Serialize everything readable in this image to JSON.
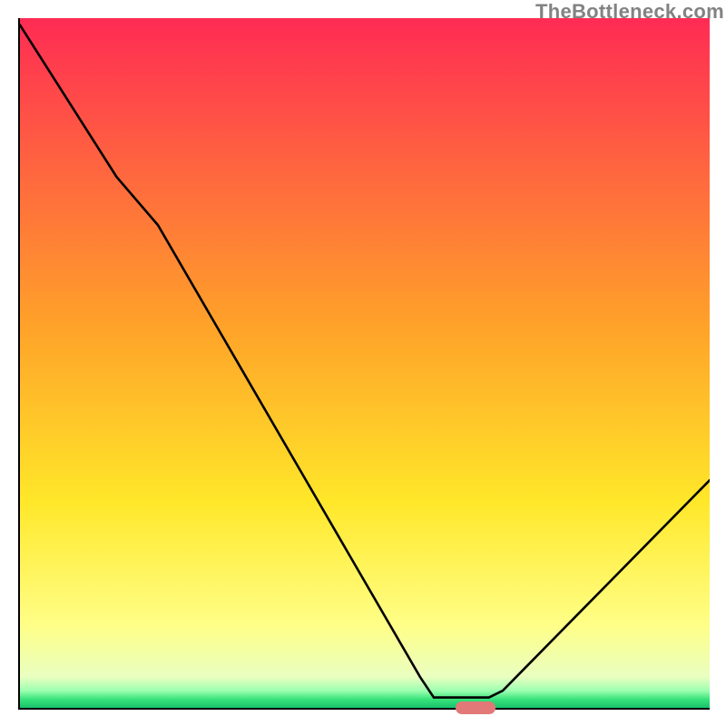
{
  "watermark": "TheBottleneck.com",
  "chart_data": {
    "type": "line",
    "xlim": [
      0,
      100
    ],
    "ylim": [
      0,
      100
    ],
    "xlabel": "",
    "ylabel": "",
    "title": "",
    "marker": {
      "x": 66,
      "y": 0,
      "color": "#e27878"
    },
    "gradient_stops": [
      {
        "offset": 0,
        "color": "#ff2b54"
      },
      {
        "offset": 0.45,
        "color": "#ffa329"
      },
      {
        "offset": 0.7,
        "color": "#ffe729"
      },
      {
        "offset": 0.88,
        "color": "#ffff87"
      },
      {
        "offset": 0.955,
        "color": "#eaffc0"
      },
      {
        "offset": 0.975,
        "color": "#9dffb1"
      },
      {
        "offset": 0.988,
        "color": "#36e27a"
      },
      {
        "offset": 1.0,
        "color": "#18c26b"
      }
    ],
    "curve_xy": [
      [
        0,
        99
      ],
      [
        14,
        77
      ],
      [
        20,
        70
      ],
      [
        58,
        4.5
      ],
      [
        60,
        1.5
      ],
      [
        68,
        1.5
      ],
      [
        70,
        2.5
      ],
      [
        100,
        33
      ]
    ]
  }
}
